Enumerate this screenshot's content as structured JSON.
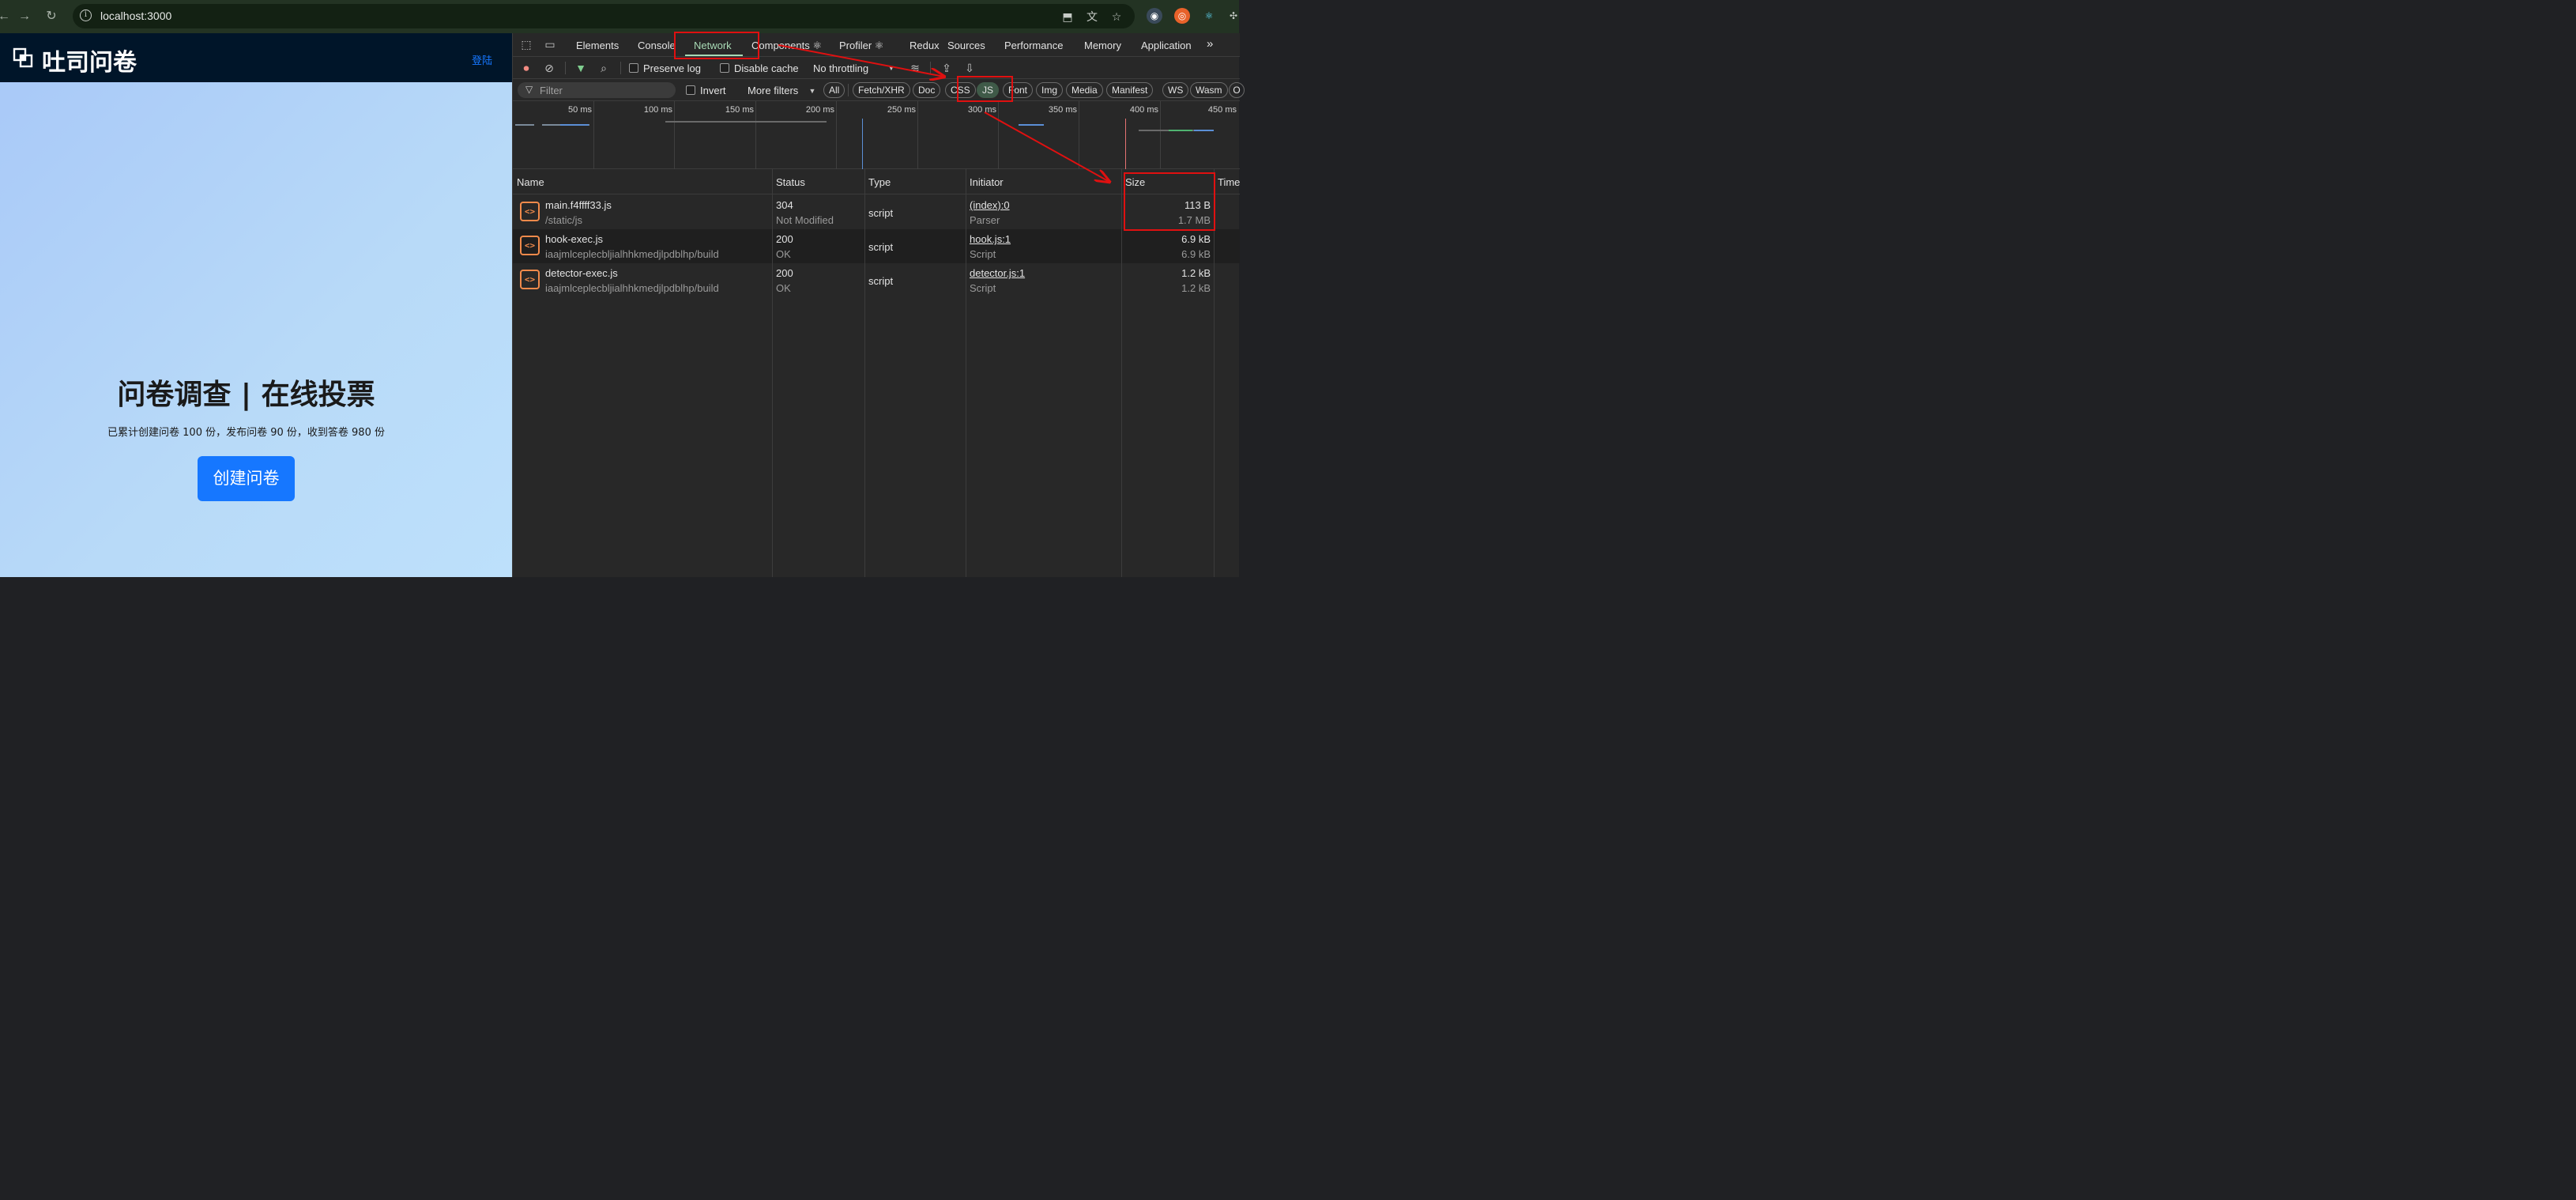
{
  "browser": {
    "back_icon": "back-arrow-icon",
    "forward_icon": "forward-arrow-icon",
    "reload_icon": "reload-icon",
    "url": "localhost:3000"
  },
  "page": {
    "logo_text": "吐司问卷",
    "login_label": "登陆",
    "hero_title": "问卷调查 | 在线投票",
    "hero_subtitle": "已累计创建问卷 100 份，发布问卷 90 份，收到答卷 980 份",
    "create_button_label": "创建问卷",
    "header_bg": "#001529",
    "accent": "#1677ff"
  },
  "devtools": {
    "tabs": [
      {
        "label": "Elements"
      },
      {
        "label": "Console"
      },
      {
        "label": "Network"
      },
      {
        "label": "Components ⚛"
      },
      {
        "label": "Profiler ⚛"
      },
      {
        "label": "Redux"
      },
      {
        "label": "Sources"
      },
      {
        "label": "Performance"
      },
      {
        "label": "Memory"
      },
      {
        "label": "Application"
      }
    ],
    "more_tabs": "»",
    "active_tab": "Network",
    "toolbar": {
      "preserve_log": "Preserve log",
      "disable_cache": "Disable cache",
      "throttling": "No throttling"
    },
    "filter": {
      "placeholder": "Filter",
      "invert": "Invert",
      "more_filters": "More filters"
    },
    "type_chips": [
      "All",
      "Fetch/XHR",
      "Doc",
      "CSS",
      "JS",
      "Font",
      "Img",
      "Media",
      "Manifest",
      "WS",
      "Wasm",
      "O"
    ],
    "active_chip": "JS",
    "overview_ticks": [
      "50 ms",
      "100 ms",
      "150 ms",
      "200 ms",
      "250 ms",
      "300 ms",
      "350 ms",
      "400 ms",
      "450 ms"
    ],
    "columns": {
      "name": "Name",
      "status": "Status",
      "type": "Type",
      "initiator": "Initiator",
      "size": "Size",
      "time": "Time"
    },
    "rows": [
      {
        "name": "main.f4ffff33.js",
        "path": "/static/js",
        "status": "304",
        "status_text": "Not Modified",
        "type": "script",
        "initiator": "(index):0",
        "initiator_type": "Parser",
        "size": "113 B",
        "resource_size": "1.7 MB"
      },
      {
        "name": "hook-exec.js",
        "path": "iaajmlceplecbljialhhkmedjlpdblhp/build",
        "status": "200",
        "status_text": "OK",
        "type": "script",
        "initiator": "hook.js:1",
        "initiator_type": "Script",
        "size": "6.9 kB",
        "resource_size": "6.9 kB"
      },
      {
        "name": "detector-exec.js",
        "path": "iaajmlceplecbljialhhkmedjlpdblhp/build",
        "status": "200",
        "status_text": "OK",
        "type": "script",
        "initiator": "detector.js:1",
        "initiator_type": "Script",
        "size": "1.2 kB",
        "resource_size": "1.2 kB"
      }
    ],
    "active_tab_color": "#a8dab5",
    "file_icon_color": "#f08a4b"
  },
  "annotation_color": "#e01010"
}
